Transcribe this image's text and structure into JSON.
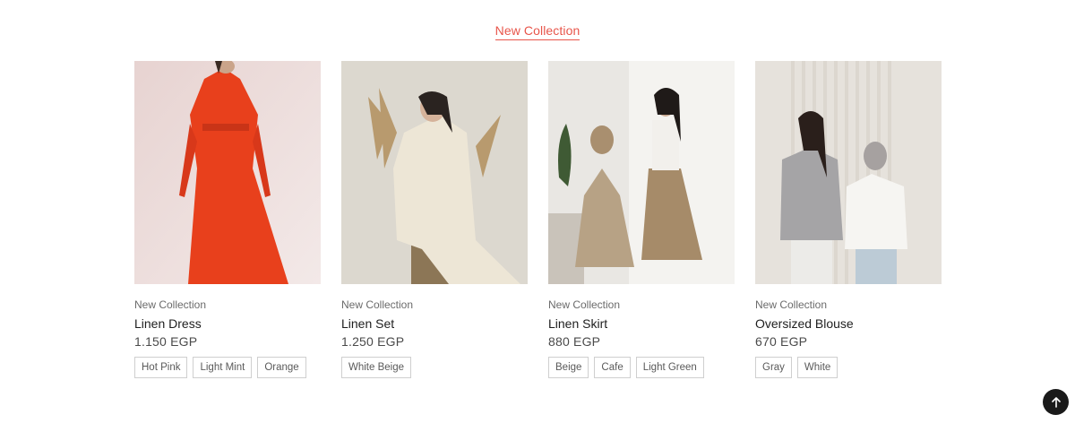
{
  "section": {
    "title": "New Collection"
  },
  "products": [
    {
      "collection": "New Collection",
      "name": "Linen Dress",
      "price": "1.150 EGP",
      "image": "orange linen dress on model",
      "colors": [
        "Hot Pink",
        "Light Mint",
        "Orange"
      ]
    },
    {
      "collection": "New Collection",
      "name": "Linen Set",
      "price": "1.250 EGP",
      "image": "white beige linen set with dried pampas",
      "colors": [
        "White Beige"
      ]
    },
    {
      "collection": "New Collection",
      "name": "Linen Skirt",
      "price": "880 EGP",
      "image": "beige linen skirts two models",
      "colors": [
        "Beige",
        "Cafe",
        "Light Green"
      ]
    },
    {
      "collection": "New Collection",
      "name": "Oversized Blouse",
      "price": "670 EGP",
      "image": "gray and white oversized blouses",
      "colors": [
        "Gray",
        "White"
      ]
    }
  ],
  "icons": {
    "back_to_top": "arrow-up-icon"
  },
  "colors": {
    "accent": "#e8554a",
    "back_to_top_bg": "#1a1a1a"
  }
}
